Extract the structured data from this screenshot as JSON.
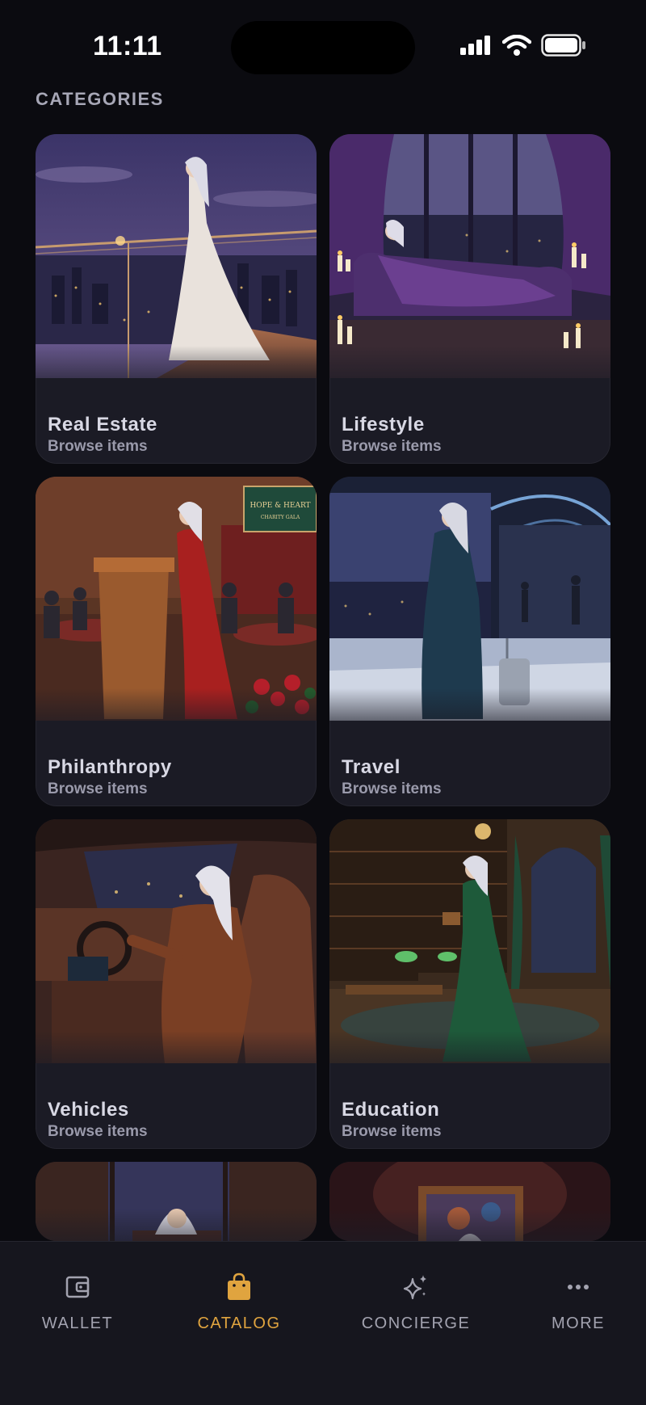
{
  "status_bar": {
    "time": "11:11",
    "icons": [
      "cellular-signal-icon",
      "wifi-icon",
      "battery-icon"
    ]
  },
  "section": {
    "title": "CATEGORIES"
  },
  "categories": [
    {
      "name": "Real Estate",
      "subtitle": "Browse items"
    },
    {
      "name": "Lifestyle",
      "subtitle": "Browse items"
    },
    {
      "name": "Philanthropy",
      "subtitle": "Browse items"
    },
    {
      "name": "Travel",
      "subtitle": "Browse items"
    },
    {
      "name": "Vehicles",
      "subtitle": "Browse items"
    },
    {
      "name": "Education",
      "subtitle": "Browse items"
    }
  ],
  "artwork_text": {
    "gala_sign": "HOPE & HEART",
    "gala_sign_sub": "CHARITY GALA"
  },
  "tabbar": {
    "tabs": [
      {
        "label": "WALLET",
        "icon": "wallet-icon"
      },
      {
        "label": "CATALOG",
        "icon": "shopping-bag-icon",
        "active": true
      },
      {
        "label": "CONCIERGE",
        "icon": "sparkles-icon"
      },
      {
        "label": "MORE",
        "icon": "more-dots-icon"
      }
    ]
  },
  "colors": {
    "accent": "#e0a43f",
    "background": "#0b0b10",
    "card": "#1b1b25"
  }
}
